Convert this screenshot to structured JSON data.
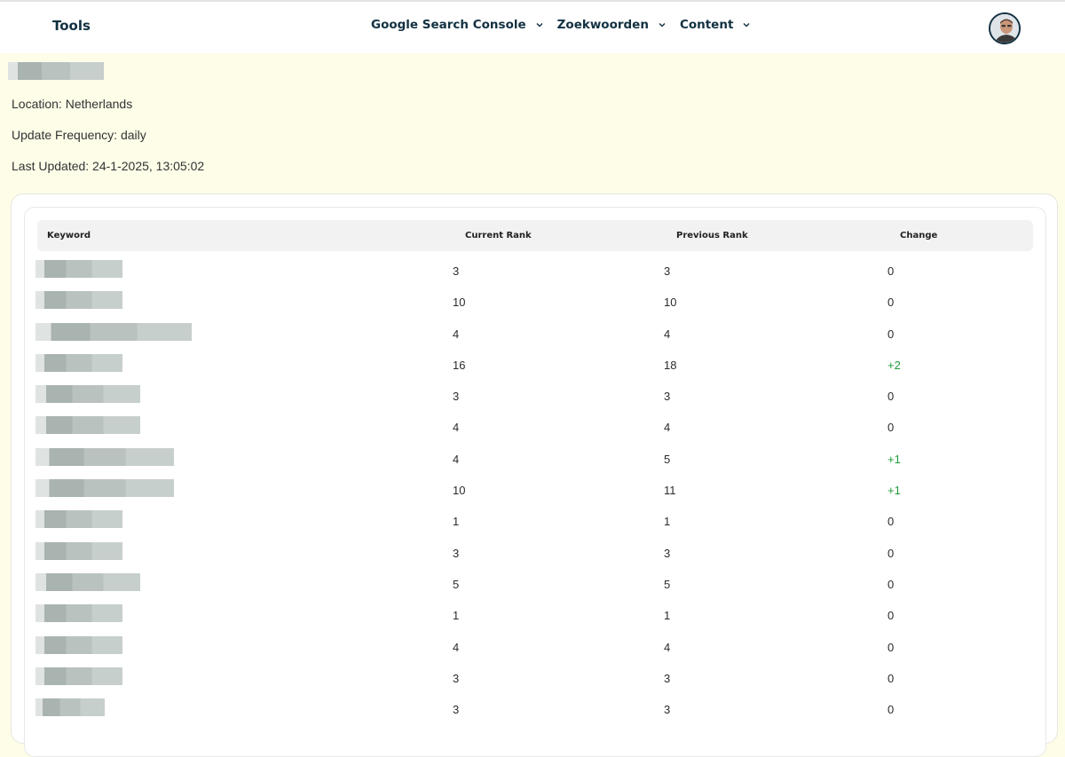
{
  "topbar": {
    "brand": "Tools",
    "nav": [
      {
        "label": "Google Search Console"
      },
      {
        "label": "Zoekwoorden"
      },
      {
        "label": "Content"
      }
    ]
  },
  "info": {
    "location": "Location: Netherlands",
    "frequency": "Update Frequency: daily",
    "updated": "Last Updated: 24-1-2025, 13:05:02"
  },
  "table": {
    "headers": [
      "Keyword",
      "Current Rank",
      "Previous Rank",
      "Change"
    ],
    "rows": [
      {
        "current": "3",
        "previous": "3",
        "change": "0"
      },
      {
        "current": "10",
        "previous": "10",
        "change": "0"
      },
      {
        "current": "4",
        "previous": "4",
        "change": "0"
      },
      {
        "current": "16",
        "previous": "18",
        "change": "+2"
      },
      {
        "current": "3",
        "previous": "3",
        "change": "0"
      },
      {
        "current": "4",
        "previous": "4",
        "change": "0"
      },
      {
        "current": "4",
        "previous": "5",
        "change": "+1"
      },
      {
        "current": "10",
        "previous": "11",
        "change": "+1"
      },
      {
        "current": "1",
        "previous": "1",
        "change": "0"
      },
      {
        "current": "3",
        "previous": "3",
        "change": "0"
      },
      {
        "current": "5",
        "previous": "5",
        "change": "0"
      },
      {
        "current": "1",
        "previous": "1",
        "change": "0"
      },
      {
        "current": "4",
        "previous": "4",
        "change": "0"
      },
      {
        "current": "3",
        "previous": "3",
        "change": "0"
      },
      {
        "current": "3",
        "previous": "3",
        "change": "0"
      }
    ]
  },
  "colors": {
    "positive_change": "#1f9a3a",
    "nav_text": "#123142",
    "page_bg": "#fdfde8"
  }
}
